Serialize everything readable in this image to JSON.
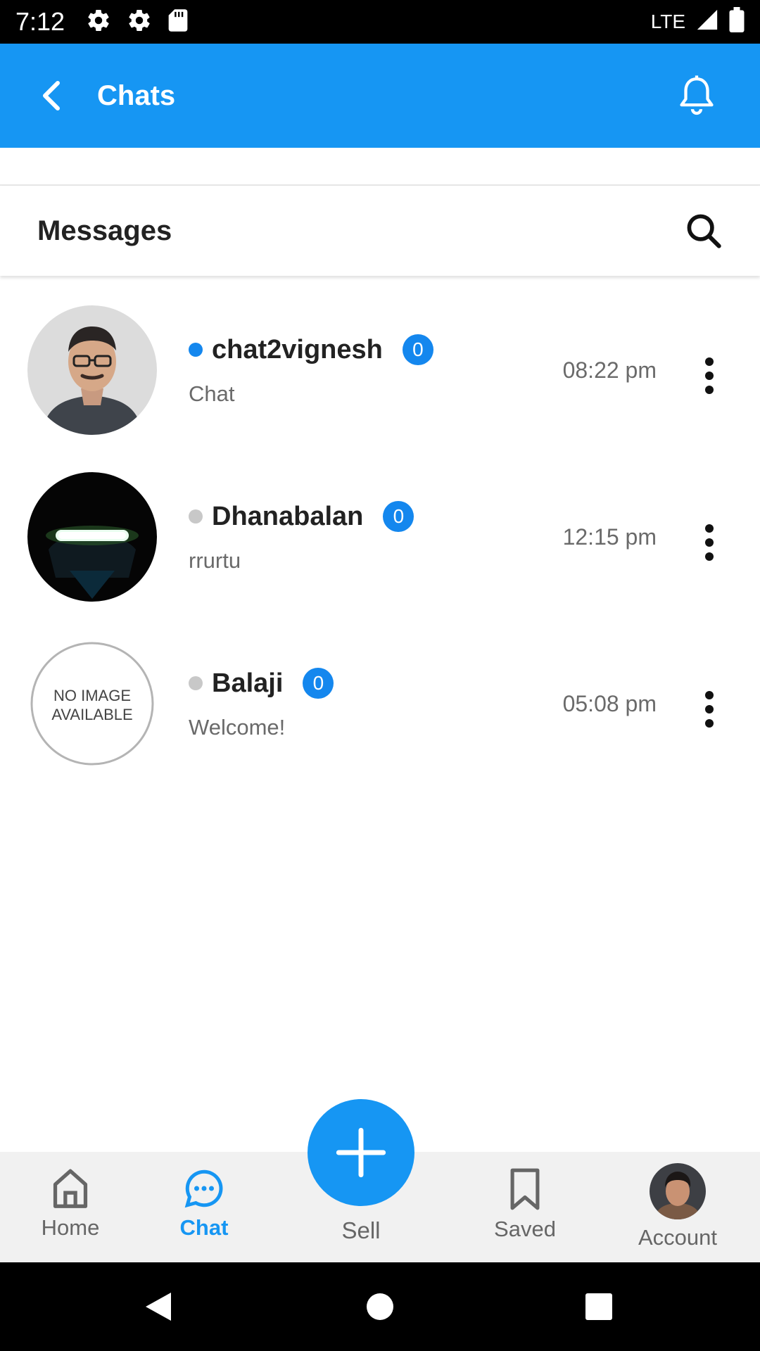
{
  "status_bar": {
    "time": "7:12",
    "network": "LTE"
  },
  "app_bar": {
    "title": "Chats"
  },
  "messages": {
    "title": "Messages"
  },
  "chats": [
    {
      "name": "chat2vignesh",
      "badge": "0",
      "preview": "Chat",
      "time": "08:22 pm",
      "online": true
    },
    {
      "name": "Dhanabalan",
      "badge": "0",
      "preview": "rrurtu",
      "time": "12:15 pm",
      "online": false
    },
    {
      "name": "Balaji",
      "badge": "0",
      "preview": "Welcome!",
      "time": "05:08 pm",
      "online": false,
      "avatar_text": [
        "NO IMAGE",
        "AVAILABLE"
      ]
    }
  ],
  "bottom_nav": {
    "home": "Home",
    "chat": "Chat",
    "sell": "Sell",
    "saved": "Saved",
    "account": "Account"
  },
  "colors": {
    "primary": "#1696f3",
    "online": "#1487ee",
    "offline": "#c8c8c8"
  }
}
